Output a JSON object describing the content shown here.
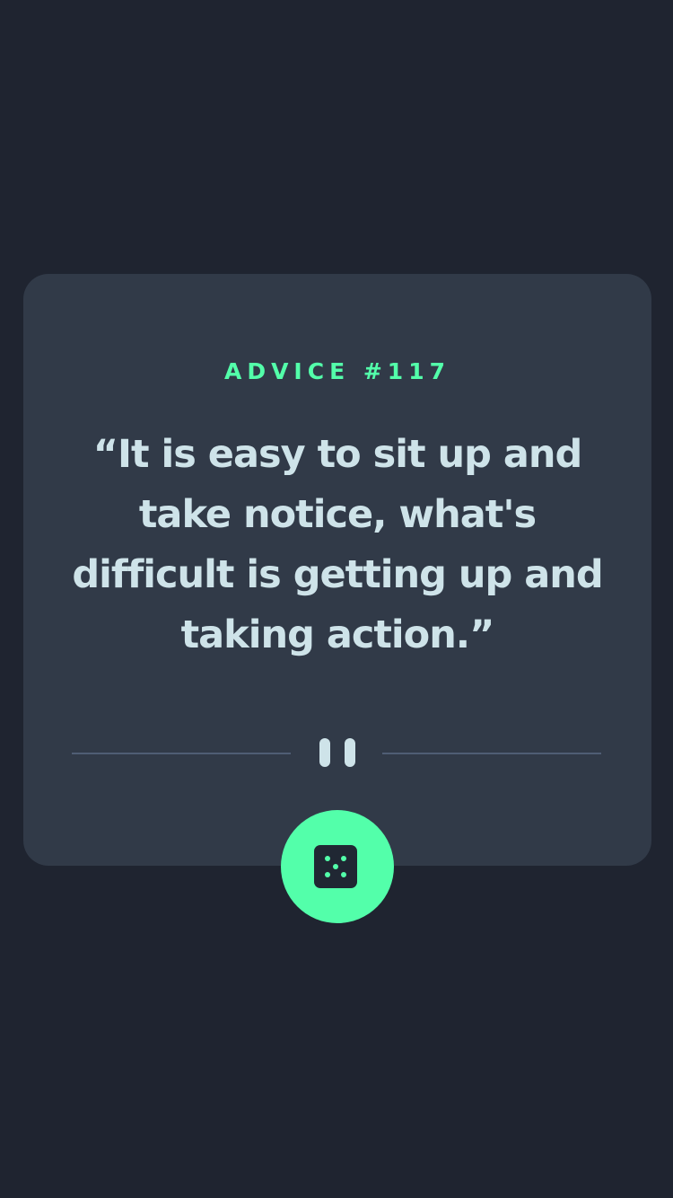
{
  "advice": {
    "label": "ADVICE #117",
    "quote": "“It is easy to sit up and take notice, what's difficult is getting up and taking action.”"
  },
  "colors": {
    "background": "#1f2430",
    "card": "#313a48",
    "accent": "#53ffaa",
    "text": "#cee3e9",
    "divider": "#4f5d74"
  },
  "icons": {
    "divider_center": "pause-icon",
    "button": "dice-icon"
  }
}
